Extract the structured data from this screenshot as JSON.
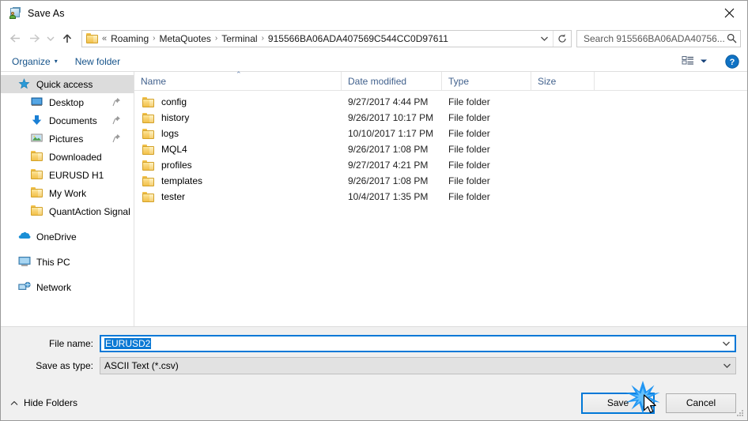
{
  "window": {
    "title": "Save As",
    "app_icon": "save-as-icon",
    "close_label": "✕"
  },
  "nav": {
    "back_icon": "back-arrow-icon",
    "forward_icon": "forward-arrow-icon",
    "recent_icon": "recent-locations-chevron-icon",
    "up_icon": "up-arrow-icon",
    "breadcrumb_lead": "«",
    "breadcrumbs": [
      {
        "label": "Roaming"
      },
      {
        "label": "MetaQuotes"
      },
      {
        "label": "Terminal"
      },
      {
        "label": "915566BA06ADA407569C544CC0D97611"
      }
    ],
    "separator": "›",
    "dropdown_icon": "chevron-down-icon",
    "refresh_icon": "refresh-icon"
  },
  "search": {
    "placeholder": "Search 915566BA06ADA40756...",
    "value": "",
    "icon": "search-icon"
  },
  "toolbar": {
    "organize_label": "Organize",
    "organize_caret": "▾",
    "new_folder_label": "New folder",
    "view_icon": "view-layout-icon",
    "view_caret": "▾",
    "help_icon": "help-icon",
    "help_glyph": "?"
  },
  "sidebar": {
    "items": [
      {
        "label": "Quick access",
        "icon": "star-icon",
        "level": "root",
        "selected": true,
        "pinned": false
      },
      {
        "label": "Desktop",
        "icon": "desktop-icon",
        "level": "child",
        "selected": false,
        "pinned": true
      },
      {
        "label": "Documents",
        "icon": "documents-download-icon",
        "level": "child",
        "selected": false,
        "pinned": true
      },
      {
        "label": "Pictures",
        "icon": "pictures-icon",
        "level": "child",
        "selected": false,
        "pinned": true
      },
      {
        "label": "Downloaded",
        "icon": "folder-icon",
        "level": "child",
        "selected": false,
        "pinned": false
      },
      {
        "label": "EURUSD H1",
        "icon": "folder-icon",
        "level": "child",
        "selected": false,
        "pinned": false
      },
      {
        "label": "My Work",
        "icon": "folder-icon",
        "level": "child",
        "selected": false,
        "pinned": false
      },
      {
        "label": "QuantAction Signal",
        "icon": "folder-icon",
        "level": "child",
        "selected": false,
        "pinned": false
      },
      {
        "label": "OneDrive",
        "icon": "onedrive-cloud-icon",
        "level": "root",
        "selected": false,
        "pinned": false,
        "gap_before": true
      },
      {
        "label": "This PC",
        "icon": "this-pc-icon",
        "level": "root",
        "selected": false,
        "pinned": false,
        "gap_before": true
      },
      {
        "label": "Network",
        "icon": "network-icon",
        "level": "root",
        "selected": false,
        "pinned": false,
        "gap_before": true
      }
    ]
  },
  "filelist": {
    "columns": [
      {
        "key": "name",
        "label": "Name",
        "sorted": "asc",
        "sort_caret": "⌃"
      },
      {
        "key": "date",
        "label": "Date modified"
      },
      {
        "key": "type",
        "label": "Type"
      },
      {
        "key": "size",
        "label": "Size"
      }
    ],
    "rows": [
      {
        "name": "config",
        "date": "9/27/2017 4:44 PM",
        "type": "File folder",
        "size": "",
        "icon": "folder-icon"
      },
      {
        "name": "history",
        "date": "9/26/2017 10:17 PM",
        "type": "File folder",
        "size": "",
        "icon": "folder-icon"
      },
      {
        "name": "logs",
        "date": "10/10/2017 1:17 PM",
        "type": "File folder",
        "size": "",
        "icon": "folder-icon"
      },
      {
        "name": "MQL4",
        "date": "9/26/2017 1:08 PM",
        "type": "File folder",
        "size": "",
        "icon": "folder-icon"
      },
      {
        "name": "profiles",
        "date": "9/27/2017 4:21 PM",
        "type": "File folder",
        "size": "",
        "icon": "folder-icon"
      },
      {
        "name": "templates",
        "date": "9/26/2017 1:08 PM",
        "type": "File folder",
        "size": "",
        "icon": "folder-icon"
      },
      {
        "name": "tester",
        "date": "10/4/2017 1:35 PM",
        "type": "File folder",
        "size": "",
        "icon": "folder-icon"
      }
    ]
  },
  "form": {
    "filename_label": "File name:",
    "filename_value": "EURUSD2",
    "filename_selected": true,
    "filetype_label": "Save as type:",
    "filetype_value": "ASCII Text (*.csv)",
    "dropdown_icon": "chevron-down-icon"
  },
  "footer": {
    "hide_folders_label": "Hide Folders",
    "hide_folders_caret": "⌃",
    "save_label": "Save",
    "cancel_label": "Cancel",
    "resize_grip": "resize-grip-icon"
  },
  "colors": {
    "accent": "#0078d7",
    "selection": "#0a78d4",
    "link": "#16538a",
    "column_header": "#41618d",
    "folder_yellow": "#f2c14a"
  }
}
